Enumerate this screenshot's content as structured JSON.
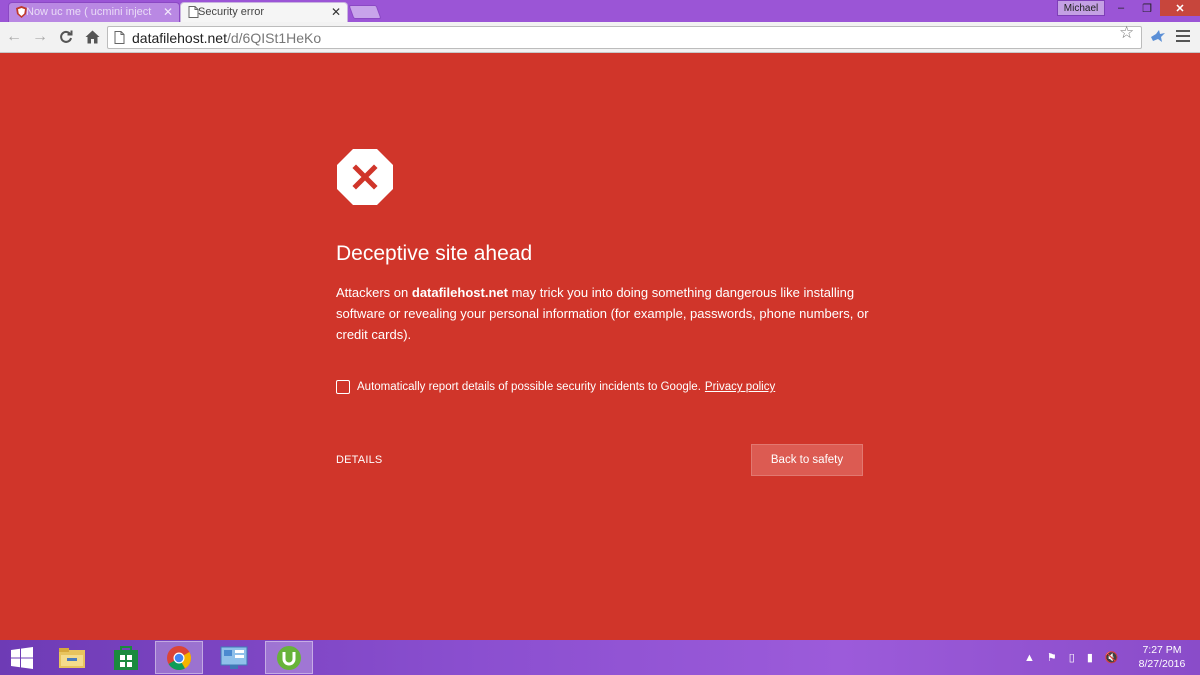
{
  "window": {
    "tabs": [
      {
        "title": "Now uc me ( ucmini inject",
        "active": false
      },
      {
        "title": "Security error",
        "active": true
      }
    ],
    "profile_name": "Michael"
  },
  "toolbar": {
    "url_host": "datafilehost.net",
    "url_path": "/d/6QISt1HeKo"
  },
  "interstitial": {
    "heading": "Deceptive site ahead",
    "explanation_prefix": "Attackers on ",
    "explanation_site": "datafilehost.net",
    "explanation_suffix": " may trick you into doing something dangerous like installing software or revealing your personal information (for example, passwords, phone numbers, or credit cards).",
    "report_label": "Automatically report details of possible security incidents to Google.",
    "privacy_link": "Privacy policy",
    "report_checked": false,
    "details_label": "DETAILS",
    "back_button": "Back to safety",
    "background_color": "#d0352a"
  },
  "taskbar": {
    "apps": [
      "start-icon",
      "file-explorer-icon",
      "store-icon",
      "chrome-icon",
      "control-panel-icon",
      "utorrent-icon"
    ],
    "clock_time": "7:27 PM",
    "clock_date": "8/27/2016"
  }
}
